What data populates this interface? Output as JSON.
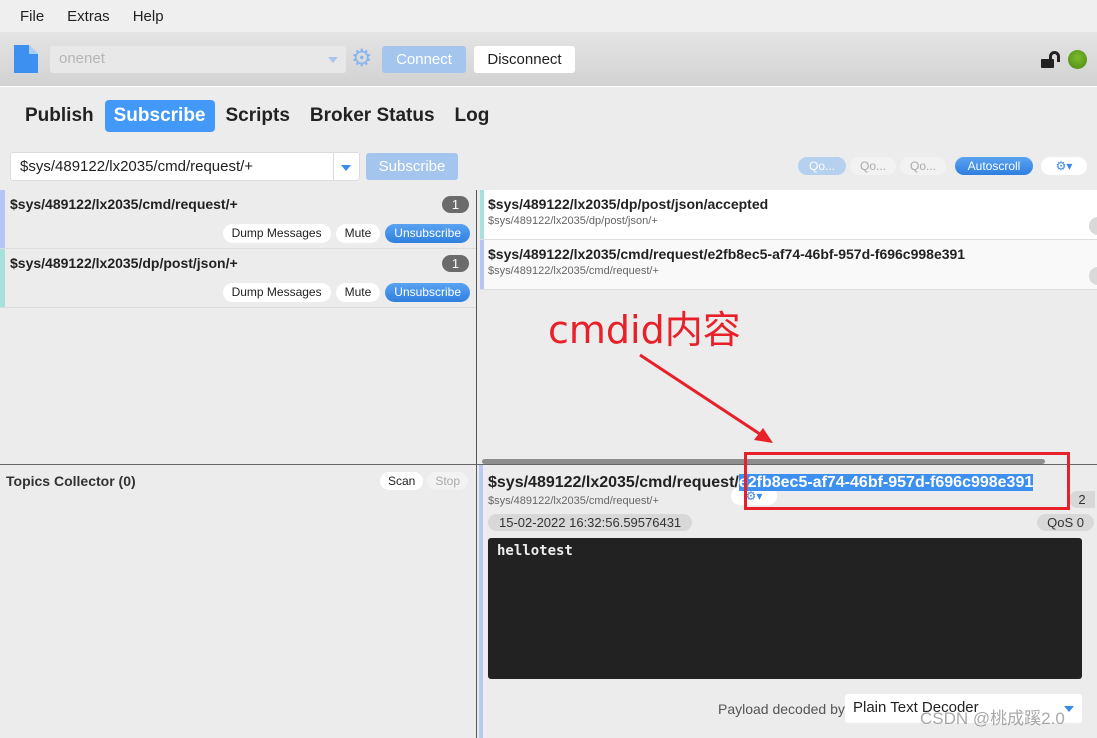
{
  "menu": [
    "File",
    "Extras",
    "Help"
  ],
  "toolbar": {
    "profile": "onenet",
    "connect_label": "Connect",
    "disconnect_label": "Disconnect",
    "lock_state": "unlocked",
    "status_color": "#5a9c1a"
  },
  "tabs": [
    {
      "label": "Publish",
      "active": false
    },
    {
      "label": "Subscribe",
      "active": true
    },
    {
      "label": "Scripts",
      "active": false
    },
    {
      "label": "Broker Status",
      "active": false
    },
    {
      "label": "Log",
      "active": false
    }
  ],
  "subscribe_bar": {
    "topic_value": "$sys/489122/lx2035/cmd/request/+",
    "subscribe_label": "Subscribe",
    "qos_buttons": [
      "Qo...",
      "Qo...",
      "Qo..."
    ],
    "autoscroll_label": "Autoscroll"
  },
  "subscriptions": [
    {
      "topic": "$sys/489122/lx2035/cmd/request/+",
      "count": "1",
      "color": "#b5c6f5",
      "dump_label": "Dump Messages",
      "mute_label": "Mute",
      "unsubscribe_label": "Unsubscribe"
    },
    {
      "topic": "$sys/489122/lx2035/dp/post/json/+",
      "count": "1",
      "color": "#a8e0dc",
      "dump_label": "Dump Messages",
      "mute_label": "Mute",
      "unsubscribe_label": "Unsubscribe"
    }
  ],
  "messages": [
    {
      "topic": "$sys/489122/lx2035/dp/post/json/accepted",
      "subscription": "$sys/489122/lx2035/dp/post/json/+",
      "color": "#a8e0dc"
    },
    {
      "topic": "$sys/489122/lx2035/cmd/request/e2fb8ec5-af74-46bf-957d-f696c998e391",
      "subscription": "$sys/489122/lx2035/cmd/request/+",
      "color": "#b5c6f5"
    }
  ],
  "topics_collector": {
    "title": "Topics Collector (0)",
    "scan_label": "Scan",
    "stop_label": "Stop"
  },
  "detail": {
    "topic_prefix": "$sys/489122/lx2035/cmd/request/",
    "topic_selected": "e2fb8ec5-af74-46bf-957d-f696c998e391",
    "subscription": "$sys/489122/lx2035/cmd/request/+",
    "message_count": "2",
    "timestamp": "15-02-2022  16:32:56.59576431",
    "qos": "QoS 0",
    "payload": "hellotest",
    "decoder_label": "Payload decoded by",
    "decoder_value": "Plain Text Decoder"
  },
  "annotation": {
    "text": "cmdid内容",
    "color": "#e8202a"
  },
  "watermark": "CSDN @桃成蹊2.0"
}
